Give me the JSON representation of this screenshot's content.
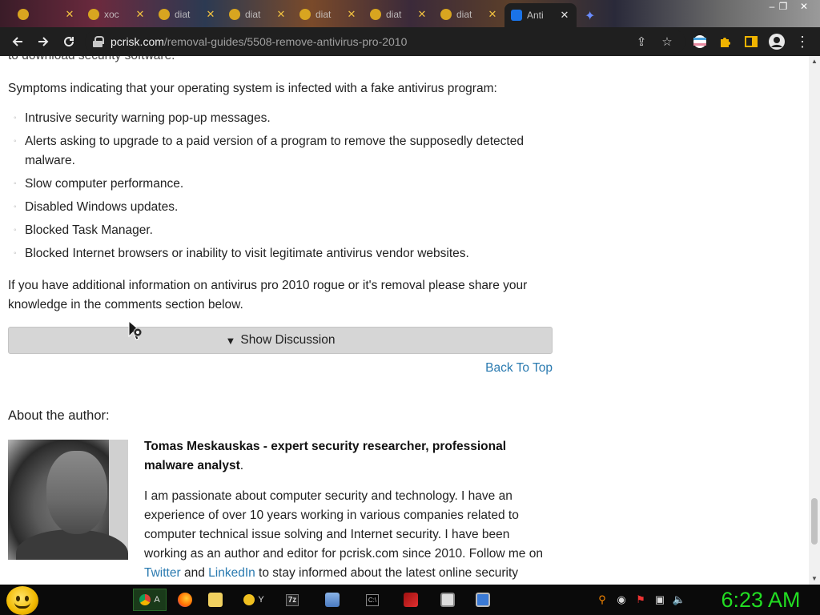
{
  "browser": {
    "tabs": [
      {
        "title": ""
      },
      {
        "title": "xoc"
      },
      {
        "title": "diat"
      },
      {
        "title": "diat"
      },
      {
        "title": "diat"
      },
      {
        "title": "diat"
      },
      {
        "title": "diat"
      },
      {
        "title": "Anti"
      }
    ],
    "address": {
      "host": "pcrisk.com",
      "path": "/removal-guides/5508-remove-antivirus-pro-2010"
    }
  },
  "page": {
    "cut_line": "to download security software.",
    "symptoms_intro": "Symptoms indicating that your operating system is infected with a fake antivirus program:",
    "symptoms": [
      "Intrusive security warning pop-up messages.",
      "Alerts asking to upgrade to a paid version of a program to remove the supposedly detected malware.",
      "Slow computer performance.",
      "Disabled Windows updates.",
      "Blocked Task Manager.",
      "Blocked Internet browsers or inability to visit legitimate antivirus vendor websites."
    ],
    "info_paragraph": "If you have additional information on antivirus pro 2010 rogue or it's removal please share your knowledge in the comments section below.",
    "discussion_button": "Show Discussion",
    "back_to_top": "Back To Top",
    "about_heading": "About the author:",
    "author_name": "Tomas Meskauskas - expert security researcher, professional malware analyst",
    "author_name_suffix": ".",
    "author_bio": {
      "part1": "I am passionate about computer security and technology. I have an experience of over 10 years working in various companies related to computer technical issue solving and Internet security. I have been working as an author and editor for pcrisk.com since 2010. Follow me on ",
      "twitter": "Twitter",
      "and": " and ",
      "linkedin": "LinkedIn",
      "part2": " to stay informed about the latest online security"
    }
  },
  "taskbar": {
    "buttons": [
      {
        "label": "A"
      },
      {
        "label": ""
      },
      {
        "label": ""
      },
      {
        "label": "Y"
      },
      {
        "label": "7z"
      },
      {
        "label": ""
      },
      {
        "label": "C:\\"
      },
      {
        "label": ""
      },
      {
        "label": ""
      },
      {
        "label": ""
      }
    ],
    "clock": "6:23 AM"
  },
  "colors": {
    "link": "#2a7ab0",
    "toolbar_bg": "#1f1f1f",
    "clock_green": "#22dd22",
    "discussion_bg": "#d6d6d6"
  }
}
